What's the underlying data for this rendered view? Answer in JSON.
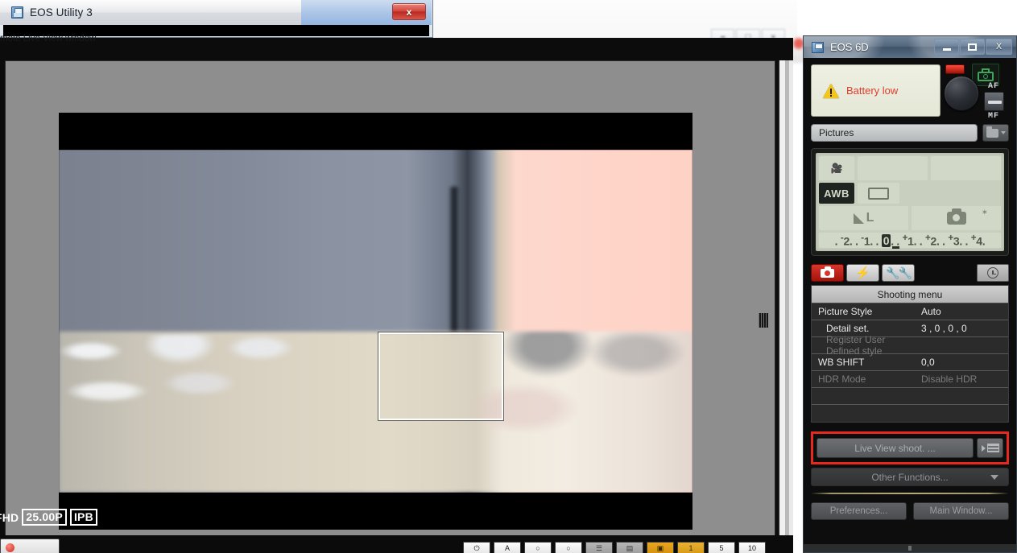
{
  "background": {
    "window_buttons": [
      "minimize-icon",
      "maximize-icon",
      "close-icon"
    ]
  },
  "eos_utility": {
    "title": "EOS Utility 3",
    "icon": "app-icon",
    "close_label": "x",
    "status_text": "mote Live View window"
  },
  "live_view": {
    "badges": [
      {
        "text": "FHD",
        "boxed": false
      },
      {
        "text": "25.00P",
        "boxed": true
      },
      {
        "text": "IPB",
        "boxed": true
      }
    ],
    "af_frame": "af-focus-frame",
    "toolbar": [
      {
        "glyph": "⏻",
        "style": "white"
      },
      {
        "glyph": "A",
        "style": "white"
      },
      {
        "glyph": "○",
        "style": "white"
      },
      {
        "glyph": "○",
        "style": "white"
      },
      {
        "glyph": "☰",
        "style": "grey"
      },
      {
        "glyph": "▤",
        "style": "grey"
      },
      {
        "glyph": "▣",
        "style": "amber"
      },
      {
        "glyph": "1",
        "style": "amber2"
      },
      {
        "glyph": "5",
        "style": "white"
      },
      {
        "glyph": "10",
        "style": "white"
      }
    ]
  },
  "eos6d": {
    "title": "EOS 6D",
    "icon": "app-icon",
    "window_buttons": {
      "minimize": "minimize-icon",
      "maximize": "maximize-icon",
      "close": "X"
    },
    "battery_warning": "Battery low",
    "af_label": "AF",
    "mf_label": "MF",
    "destination": {
      "value": "Pictures",
      "folder_button": "folder-browse-icon"
    },
    "lcd": {
      "movie_icon": "movie-camera-icon",
      "white_balance": "AWB",
      "drive_mode": "single-shot-icon",
      "quality": "L",
      "shots_icon": "camera-icon",
      "exposure_scale": ". -2. . -1. . 0. . +1. . +2. . +3. . +4."
    },
    "tabs": [
      {
        "name": "shooting-tab",
        "icon": "camera-icon",
        "active": true
      },
      {
        "name": "flash-tab",
        "icon": "flash-icon",
        "active": false
      },
      {
        "name": "setup-tab",
        "icon": "tools-icon",
        "active": false
      }
    ],
    "timer_button": "timer-icon",
    "menu": {
      "title": "Shooting menu",
      "rows": [
        {
          "key": "Picture Style",
          "value": "Auto",
          "dim": false,
          "indent": false
        },
        {
          "key": "Detail set.",
          "value": "3 , 0 , 0 , 0",
          "dim": false,
          "indent": true
        },
        {
          "key": "Register User Defined style",
          "value": "",
          "dim": true,
          "indent": true
        },
        {
          "key": "WB SHIFT",
          "value": "0,0",
          "dim": false,
          "indent": false
        },
        {
          "key": "HDR Mode",
          "value": "Disable HDR",
          "dim": true,
          "indent": false
        },
        {
          "key": "",
          "value": "",
          "dim": true,
          "indent": false
        },
        {
          "key": "",
          "value": "",
          "dim": true,
          "indent": false
        }
      ]
    },
    "live_view_shoot_label": "Live View shoot. ...",
    "live_view_shoot_icon": "live-view-icon",
    "other_functions_label": "Other Functions...",
    "preferences_label": "Preferences...",
    "main_window_label": "Main Window...",
    "highlight_color": "#e8281e"
  }
}
